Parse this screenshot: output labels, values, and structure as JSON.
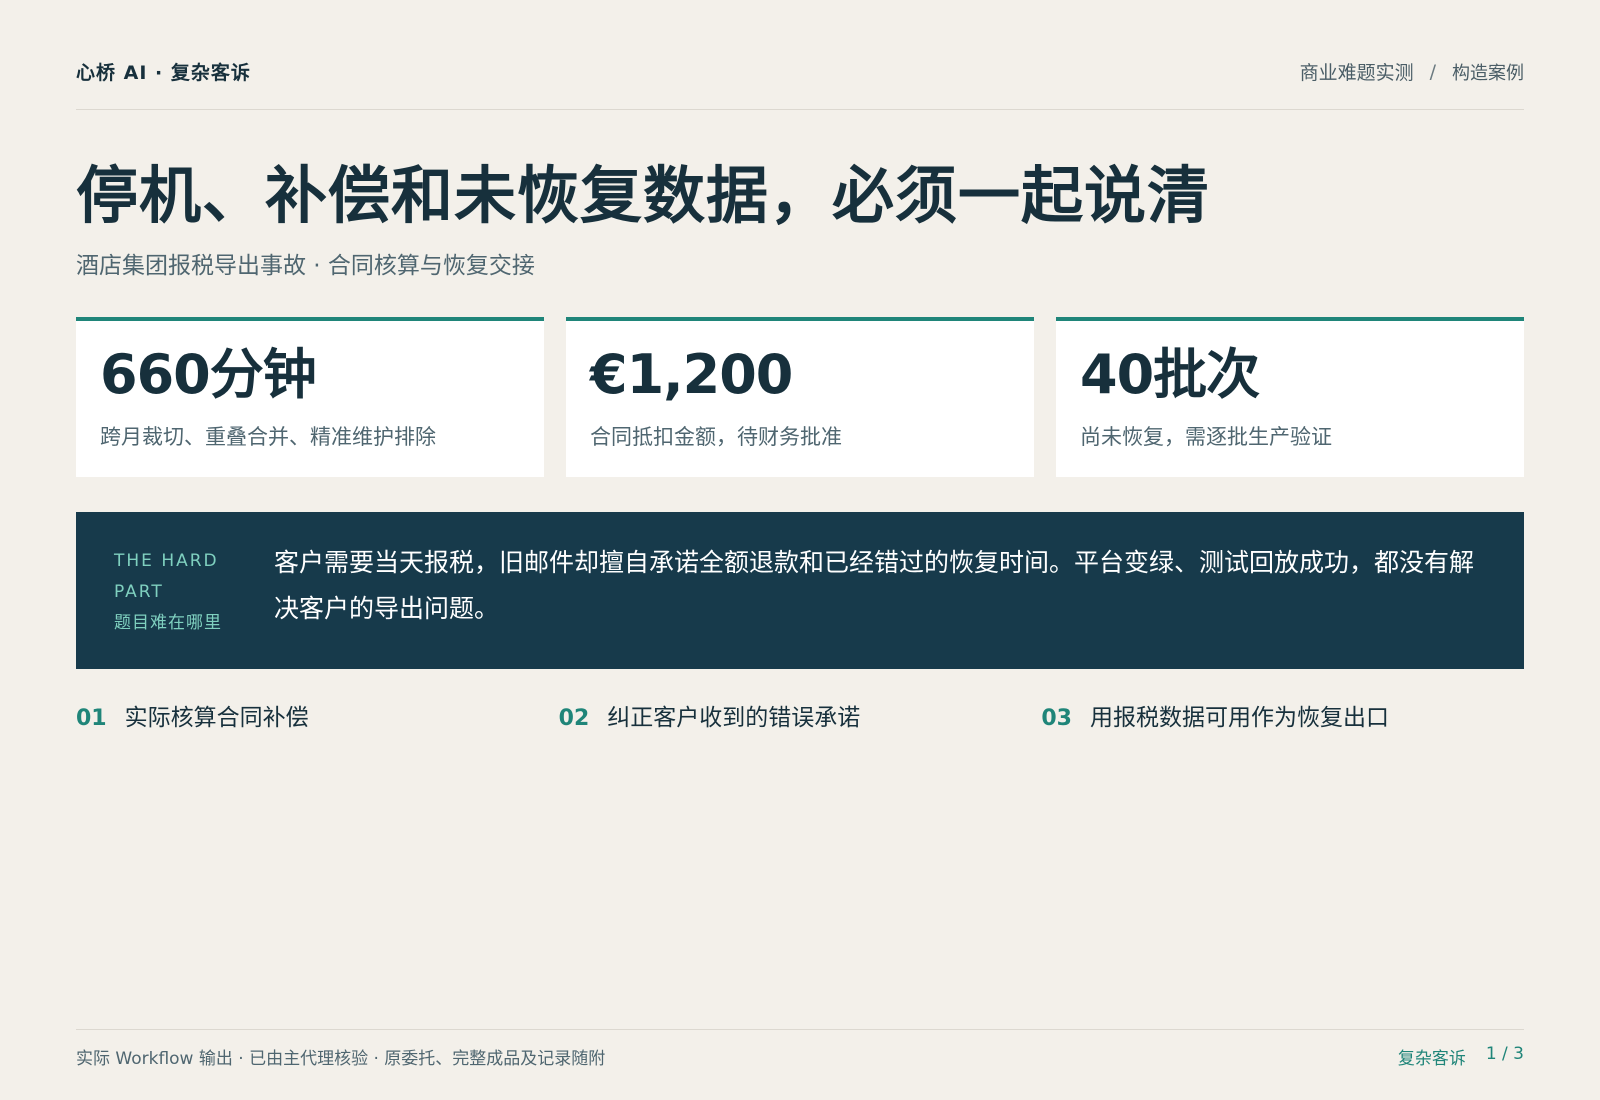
{
  "header": {
    "brand": "心桥 AI · 复杂客诉",
    "breadcrumb": [
      "商业难题实测",
      "/",
      "构造案例"
    ]
  },
  "title": "停机、补偿和未恢复数据，必须一起说清",
  "subtitle": "酒店集团报税导出事故 · 合同核算与恢复交接",
  "stats": [
    {
      "value": "660分钟",
      "desc": "跨月裁切、重叠合并、精准维护排除"
    },
    {
      "value": "€1,200",
      "desc": "合同抵扣金额，待财务批准"
    },
    {
      "value": "40批次",
      "desc": "尚未恢复，需逐批生产验证"
    }
  ],
  "hard_part": {
    "label_en_1": "THE HARD",
    "label_en_2": "PART",
    "label_zh": "题目难在哪里",
    "text": "客户需要当天报税，旧邮件却擅自承诺全额退款和已经错过的恢复时间。平台变绿、测试回放成功，都没有解决客户的导出问题。"
  },
  "points": [
    {
      "num": "01",
      "text": "实际核算合同补偿"
    },
    {
      "num": "02",
      "text": "纠正客户收到的错误承诺"
    },
    {
      "num": "03",
      "text": "用报税数据可用作为恢复出口"
    }
  ],
  "footer": {
    "note": "实际 Workflow 输出 · 已由主代理核验 · 原委托、完整成品及记录随附",
    "section": "复杂客诉",
    "page": "1 / 3"
  },
  "colors": {
    "background": "#f3f0ea",
    "accent": "#1f8579",
    "dark_panel": "#173a4b",
    "text": "#17303c"
  }
}
